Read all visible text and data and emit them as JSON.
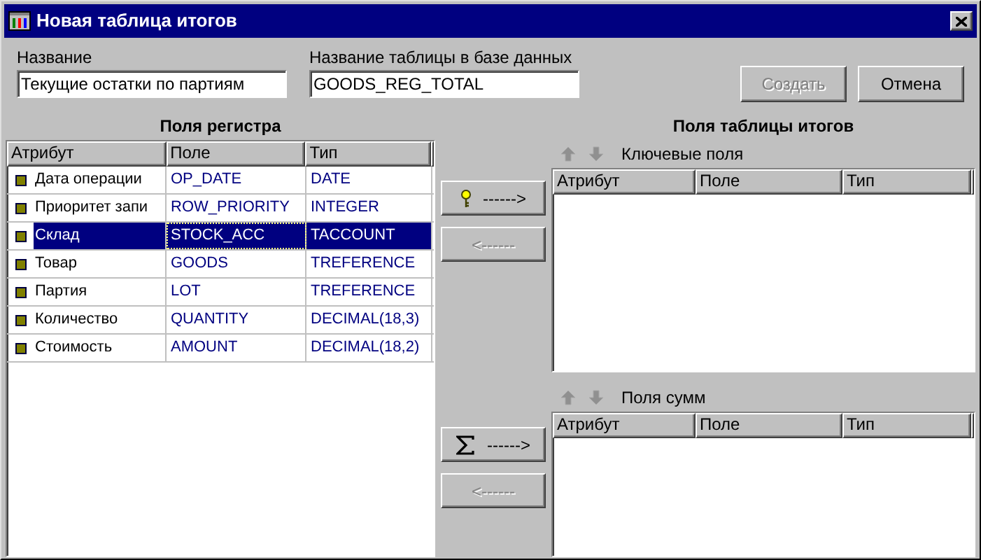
{
  "window": {
    "title": "Новая таблица итогов"
  },
  "name_field": {
    "label": "Название",
    "value": "Текущие остатки по партиям"
  },
  "db_name_field": {
    "label": "Название таблицы в базе данных",
    "value": "GOODS_REG_TOTAL"
  },
  "buttons": [
    {
      "label": "Создать",
      "disabled": true
    },
    {
      "label": "Отмена",
      "disabled": false
    }
  ],
  "register_fields": {
    "title": "Поля регистра",
    "columns": [
      "Атрибут",
      "Поле",
      "Тип"
    ],
    "rows": [
      {
        "attribute": "Дата операции",
        "field": "OP_DATE",
        "type": "DATE",
        "selected": false
      },
      {
        "attribute": "Приоритет запи",
        "field": "ROW_PRIORITY",
        "type": "INTEGER",
        "selected": false
      },
      {
        "attribute": "Склад",
        "field": "STOCK_ACC",
        "type": "TACCOUNT",
        "selected": true
      },
      {
        "attribute": "Товар",
        "field": "GOODS",
        "type": "TREFERENCE",
        "selected": false
      },
      {
        "attribute": "Партия",
        "field": "LOT",
        "type": "TREFERENCE",
        "selected": false
      },
      {
        "attribute": "Количество",
        "field": "QUANTITY",
        "type": "DECIMAL(18,3)",
        "selected": false
      },
      {
        "attribute": "Стоимость",
        "field": "AMOUNT",
        "type": "DECIMAL(18,2)",
        "selected": false
      }
    ]
  },
  "total_fields": {
    "title": "Поля таблицы итогов",
    "sections": [
      {
        "label": "Ключевые поля",
        "columns": [
          "Атрибут",
          "Поле",
          "Тип"
        ],
        "add": {
          "kind": "key",
          "label": "------>",
          "disabled": false
        },
        "remove": {
          "label": "<------",
          "disabled": true
        }
      },
      {
        "label": "Поля сумм",
        "columns": [
          "Атрибут",
          "Поле",
          "Тип"
        ],
        "add": {
          "kind": "sum",
          "label": "------>",
          "disabled": false
        },
        "remove": {
          "label": "<------",
          "disabled": true
        }
      }
    ]
  }
}
